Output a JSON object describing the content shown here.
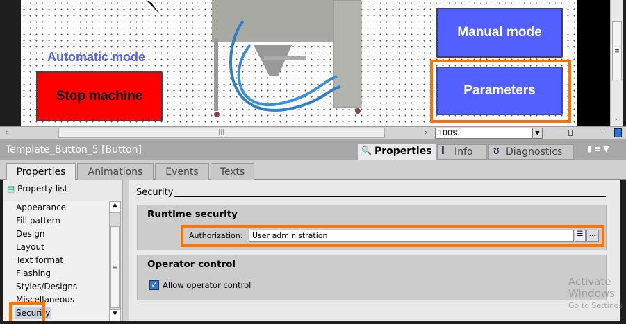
{
  "canvas": {
    "automatic_mode_label": "Automatic mode",
    "stop_button": "Stop machine",
    "manual_button": "Manual mode",
    "parameters_button": "Parameters",
    "stop_color": "#ff0000",
    "blue_color": "#5260ff"
  },
  "toolbar": {
    "zoom": "100%"
  },
  "header": {
    "title": "Template_Button_5 [Button]",
    "tabs": [
      "Properties",
      "Info",
      "Diagnostics"
    ]
  },
  "subtabs": [
    "Properties",
    "Animations",
    "Events",
    "Texts"
  ],
  "sidebar": {
    "property_list": "Property list",
    "items": [
      "Appearance",
      "Fill pattern",
      "Design",
      "Layout",
      "Text format",
      "Flashing",
      "Styles/Designs",
      "Miscellaneous",
      "Security"
    ]
  },
  "security": {
    "section_title": "Security",
    "runtime_title": "Runtime security",
    "auth_label": "Authorization:",
    "auth_value": "User administration",
    "operator_title": "Operator control",
    "allow_label": "Allow operator control",
    "allow_checked": true
  },
  "watermark": {
    "line1": "Activate Windows",
    "line2": "Go to Settings"
  }
}
